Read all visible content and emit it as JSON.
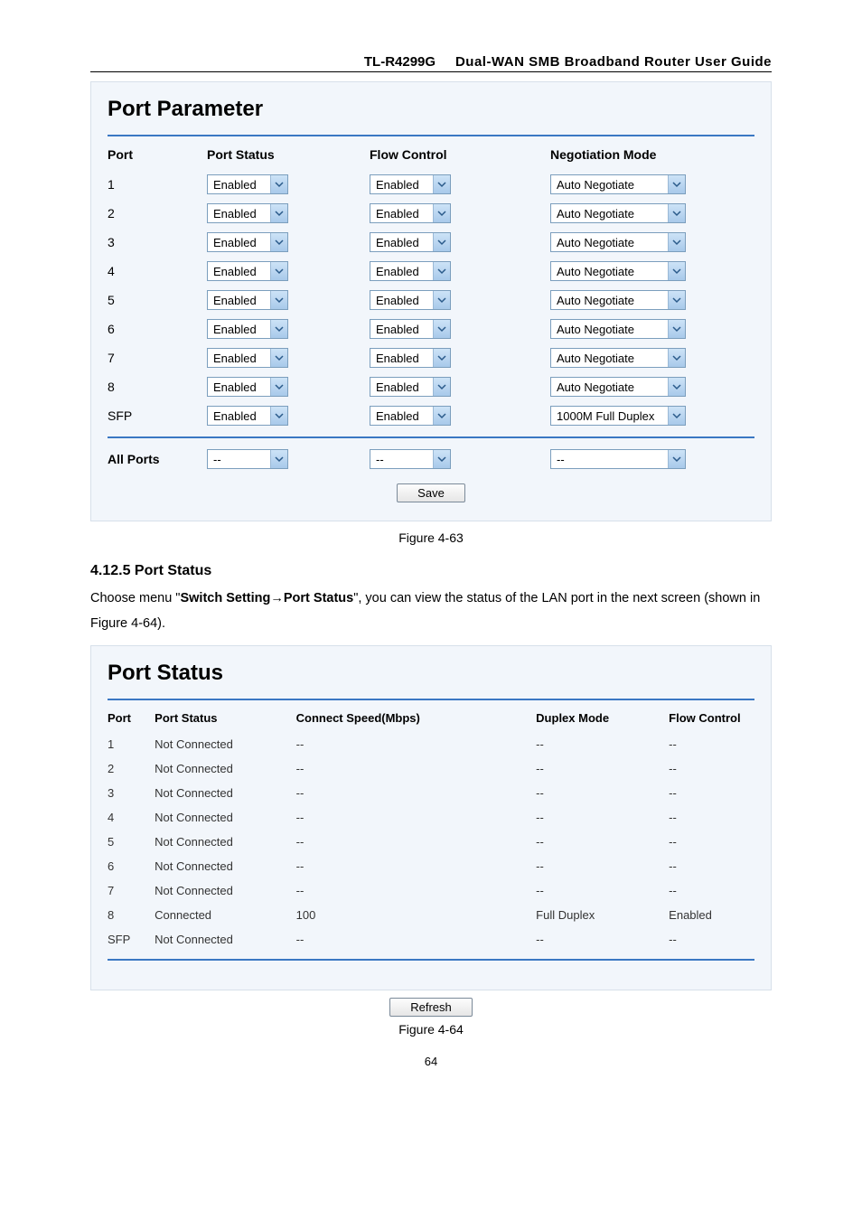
{
  "header": {
    "model": "TL-R4299G",
    "title": "Dual-WAN SMB Broadband Router User Guide"
  },
  "port_parameter": {
    "title": "Port Parameter",
    "columns": {
      "port": "Port",
      "status": "Port Status",
      "flow": "Flow Control",
      "neg": "Negotiation Mode"
    },
    "rows": [
      {
        "port": "1",
        "status": "Enabled",
        "flow": "Enabled",
        "neg": "Auto Negotiate"
      },
      {
        "port": "2",
        "status": "Enabled",
        "flow": "Enabled",
        "neg": "Auto Negotiate"
      },
      {
        "port": "3",
        "status": "Enabled",
        "flow": "Enabled",
        "neg": "Auto Negotiate"
      },
      {
        "port": "4",
        "status": "Enabled",
        "flow": "Enabled",
        "neg": "Auto Negotiate"
      },
      {
        "port": "5",
        "status": "Enabled",
        "flow": "Enabled",
        "neg": "Auto Negotiate"
      },
      {
        "port": "6",
        "status": "Enabled",
        "flow": "Enabled",
        "neg": "Auto Negotiate"
      },
      {
        "port": "7",
        "status": "Enabled",
        "flow": "Enabled",
        "neg": "Auto Negotiate"
      },
      {
        "port": "8",
        "status": "Enabled",
        "flow": "Enabled",
        "neg": "Auto Negotiate"
      },
      {
        "port": "SFP",
        "status": "Enabled",
        "flow": "Enabled",
        "neg": "1000M Full Duplex"
      }
    ],
    "all_ports": {
      "label": "All Ports",
      "status": "--",
      "flow": "--",
      "neg": "--"
    },
    "save_label": "Save"
  },
  "caption1": "Figure 4-63",
  "heading": "4.12.5  Port Status",
  "paragraph": {
    "prefix": "Choose menu \"",
    "link1": "Switch Setting",
    "arrow": "→",
    "link2": "Port Status",
    "suffix": "\", you can view the status of the LAN port in the next screen (shown in Figure 4-64)."
  },
  "port_status": {
    "title": "Port Status",
    "columns": {
      "port": "Port",
      "status": "Port Status",
      "speed": "Connect Speed(Mbps)",
      "duplex": "Duplex Mode",
      "flow": "Flow Control"
    },
    "rows": [
      {
        "port": "1",
        "status": "Not Connected",
        "speed": "--",
        "duplex": "--",
        "flow": "--"
      },
      {
        "port": "2",
        "status": "Not Connected",
        "speed": "--",
        "duplex": "--",
        "flow": "--"
      },
      {
        "port": "3",
        "status": "Not Connected",
        "speed": "--",
        "duplex": "--",
        "flow": "--"
      },
      {
        "port": "4",
        "status": "Not Connected",
        "speed": "--",
        "duplex": "--",
        "flow": "--"
      },
      {
        "port": "5",
        "status": "Not Connected",
        "speed": "--",
        "duplex": "--",
        "flow": "--"
      },
      {
        "port": "6",
        "status": "Not Connected",
        "speed": "--",
        "duplex": "--",
        "flow": "--"
      },
      {
        "port": "7",
        "status": "Not Connected",
        "speed": "--",
        "duplex": "--",
        "flow": "--"
      },
      {
        "port": "8",
        "status": "Connected",
        "speed": "100",
        "duplex": "Full Duplex",
        "flow": "Enabled"
      },
      {
        "port": "SFP",
        "status": "Not Connected",
        "speed": "--",
        "duplex": "--",
        "flow": "--"
      }
    ],
    "refresh_label": "Refresh"
  },
  "caption2": "Figure 4-64",
  "page_number": "64"
}
